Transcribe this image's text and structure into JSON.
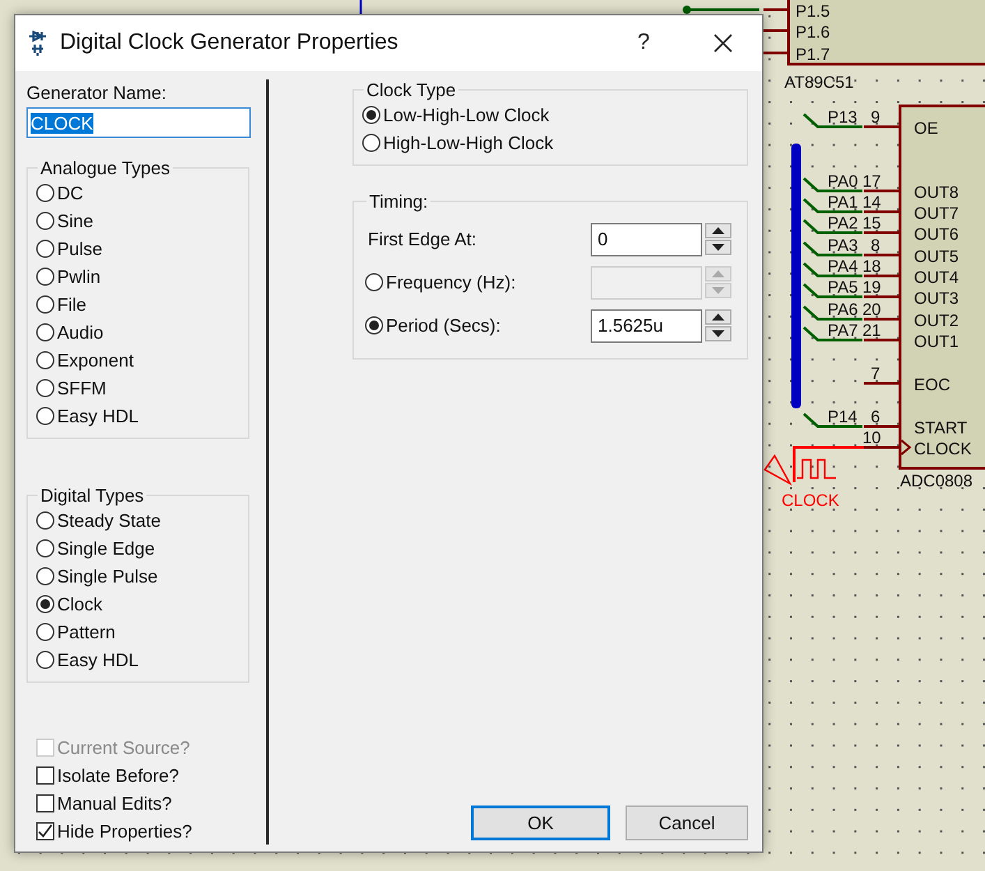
{
  "dialog": {
    "title": "Digital Clock Generator Properties",
    "help": "?"
  },
  "generator_name": {
    "label": "Generator Name:",
    "value": "CLOCK",
    "selected": true
  },
  "analogue_types": {
    "title": "Analogue Types",
    "options": [
      {
        "label": "DC",
        "selected": false
      },
      {
        "label": "Sine",
        "selected": false
      },
      {
        "label": "Pulse",
        "selected": false
      },
      {
        "label": "Pwlin",
        "selected": false
      },
      {
        "label": "File",
        "selected": false
      },
      {
        "label": "Audio",
        "selected": false
      },
      {
        "label": "Exponent",
        "selected": false
      },
      {
        "label": "SFFM",
        "selected": false
      },
      {
        "label": "Easy HDL",
        "selected": false
      }
    ]
  },
  "digital_types": {
    "title": "Digital Types",
    "options": [
      {
        "label": "Steady State",
        "selected": false
      },
      {
        "label": "Single Edge",
        "selected": false
      },
      {
        "label": "Single Pulse",
        "selected": false
      },
      {
        "label": "Clock",
        "selected": true
      },
      {
        "label": "Pattern",
        "selected": false
      },
      {
        "label": "Easy HDL",
        "selected": false
      }
    ]
  },
  "flags": [
    {
      "label": "Current Source?",
      "checked": false,
      "disabled": true
    },
    {
      "label": "Isolate Before?",
      "checked": false,
      "disabled": false
    },
    {
      "label": "Manual Edits?",
      "checked": false,
      "disabled": false
    },
    {
      "label": "Hide Properties?",
      "checked": true,
      "disabled": false
    }
  ],
  "clock_type": {
    "title": "Clock Type",
    "options": [
      {
        "label": "Low-High-Low Clock",
        "selected": true
      },
      {
        "label": "High-Low-High Clock",
        "selected": false
      }
    ]
  },
  "timing": {
    "title": "Timing:",
    "fields": [
      {
        "kind": "plain",
        "label": "First Edge At:",
        "value": "0",
        "disabled": false
      },
      {
        "kind": "radio",
        "label": "Frequency (Hz):",
        "selected": false,
        "disabled": true
      },
      {
        "kind": "radio",
        "label": "Period (Secs):",
        "selected": true,
        "value": "1.5625u",
        "disabled": false
      }
    ]
  },
  "buttons": [
    {
      "label": "OK",
      "default": true
    },
    {
      "label": "Cancel",
      "default": false
    }
  ],
  "schematic": {
    "mcu_pins": [
      "P1.5",
      "P1.6",
      "P1.7"
    ],
    "mcu_label": "AT89C51",
    "adc_label": "ADC0808",
    "generator_label": "CLOCK",
    "adc_pins": [
      {
        "kind": "plain",
        "name": "OE",
        "number": "9",
        "net": "P13"
      },
      {
        "kind": "plain",
        "name": "OUT8",
        "number": "17",
        "net": "PA0"
      },
      {
        "kind": "plain",
        "name": "OUT7",
        "number": "14",
        "net": "PA1"
      },
      {
        "kind": "plain",
        "name": "OUT6",
        "number": "15",
        "net": "PA2"
      },
      {
        "kind": "plain",
        "name": "OUT5",
        "number": "8",
        "net": "PA3"
      },
      {
        "kind": "plain",
        "name": "OUT4",
        "number": "18",
        "net": "PA4"
      },
      {
        "kind": "plain",
        "name": "OUT3",
        "number": "19",
        "net": "PA5"
      },
      {
        "kind": "plain",
        "name": "OUT2",
        "number": "20",
        "net": "PA6"
      },
      {
        "kind": "plain",
        "name": "OUT1",
        "number": "21",
        "net": "PA7"
      },
      {
        "kind": "plain",
        "name": "EOC",
        "number": "7"
      },
      {
        "kind": "plain",
        "name": "START",
        "number": "6",
        "net": "P14"
      },
      {
        "kind": "clock",
        "name": "CLOCK",
        "number": "10"
      }
    ]
  }
}
